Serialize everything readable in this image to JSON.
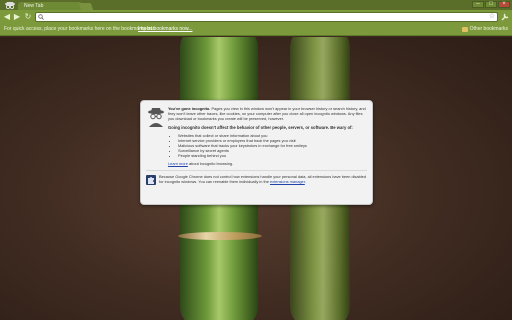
{
  "tabs": [
    {
      "label": "New Tab"
    }
  ],
  "window_controls": {
    "minimize": "–",
    "maximize": "□",
    "close": "×"
  },
  "toolbar": {
    "back": "◀",
    "forward": "▶",
    "reload": "↻",
    "address_value": ""
  },
  "bookmarks_bar": {
    "hint": "For quick access, place your bookmarks here on the bookmarks bar.",
    "import_link": "Import bookmarks now...",
    "other_bookmarks": "Other bookmarks"
  },
  "incognito": {
    "intro_bold": "You've gone incognito.",
    "intro_text": "Pages you view in this window won't appear in your browser history or search history, and they won't leave other traces, like cookies, on your computer after you close all open incognito windows. Any files you download or bookmarks you create will be preserved, however.",
    "heading": "Going incognito doesn't affect the behavior of other people, servers, or software. Be wary of:",
    "risks": [
      "Websites that collect or share information about you",
      "Internet service providers or employers that track the pages you visit",
      "Malicious software that tracks your keystrokes in exchange for free smileys",
      "Surveillance by secret agents",
      "People standing behind you"
    ],
    "learn_more_link": "Learn more",
    "learn_more_text": "about incognito browsing.",
    "extensions_text": "Because Google Chrome does not control how extensions handle your personal data, all extensions have been disabled for incognito windows. You can reenable them individually in the",
    "extensions_link": "extensions manager",
    "extensions_end": "."
  },
  "colors": {
    "theme_green": "#7c9a3c",
    "frame_green": "#5a6e2a",
    "link_blue": "#2244aa"
  }
}
